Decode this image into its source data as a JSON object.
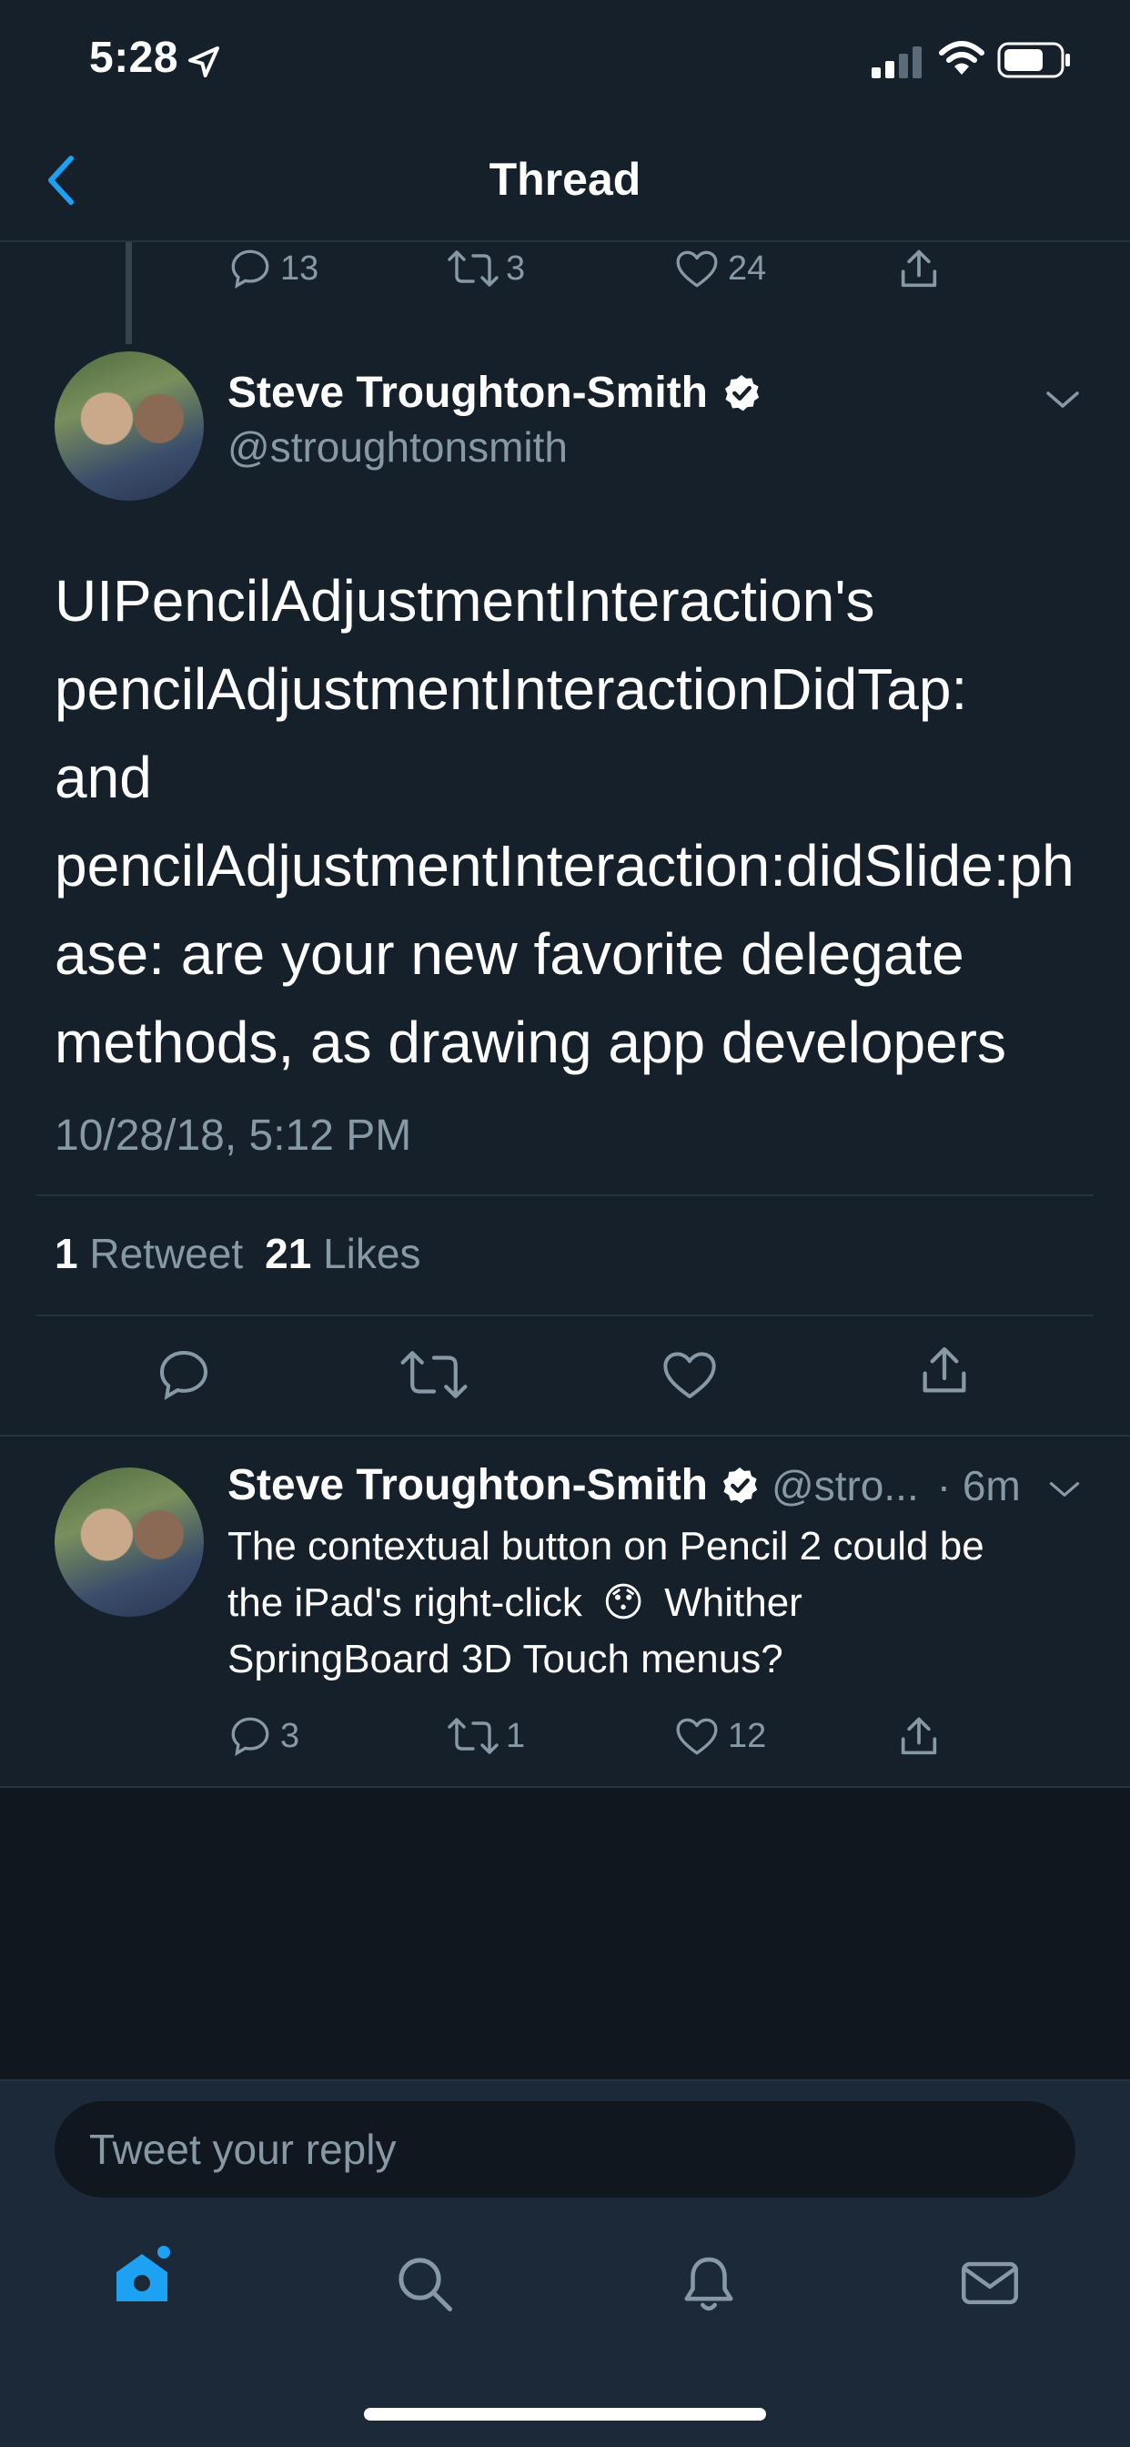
{
  "status_bar": {
    "time": "5:28"
  },
  "nav": {
    "title": "Thread"
  },
  "prev_tweet_actions": {
    "replies": "13",
    "retweets": "3",
    "likes": "24"
  },
  "main_tweet": {
    "name": "Steve Troughton-Smith",
    "handle": "@stroughtonsmith",
    "lines": [
      "UIPencilAdjustmentInteraction's",
      "pencilAdjustmentInteractionDidTap:",
      "and",
      "pencilAdjustmentInteraction:didSlide:ph",
      "ase: are your new favorite delegate",
      "methods, as drawing app developers"
    ],
    "timestamp": "10/28/18, 5:12 PM",
    "retweet_count": "1",
    "retweet_label": "Retweet",
    "like_count": "21",
    "like_label": "Likes"
  },
  "reply_tweet": {
    "name": "Steve Troughton-Smith",
    "handle": "@stro...",
    "time": "· 6m",
    "line1": "The contextual button on Pencil 2 could be",
    "line2a": "the iPad's right-click",
    "emoji": "😯",
    "line2b": "Whither",
    "line3": "SpringBoard 3D Touch menus?",
    "replies": "3",
    "retweets": "1",
    "likes": "12"
  },
  "composer": {
    "placeholder": "Tweet your reply"
  },
  "tabbar": {
    "items": [
      "home-icon",
      "search-icon",
      "bell-icon",
      "mail-icon"
    ]
  },
  "colors": {
    "background": "#15202b",
    "accent": "#1da1f2",
    "muted": "#8899a6"
  }
}
